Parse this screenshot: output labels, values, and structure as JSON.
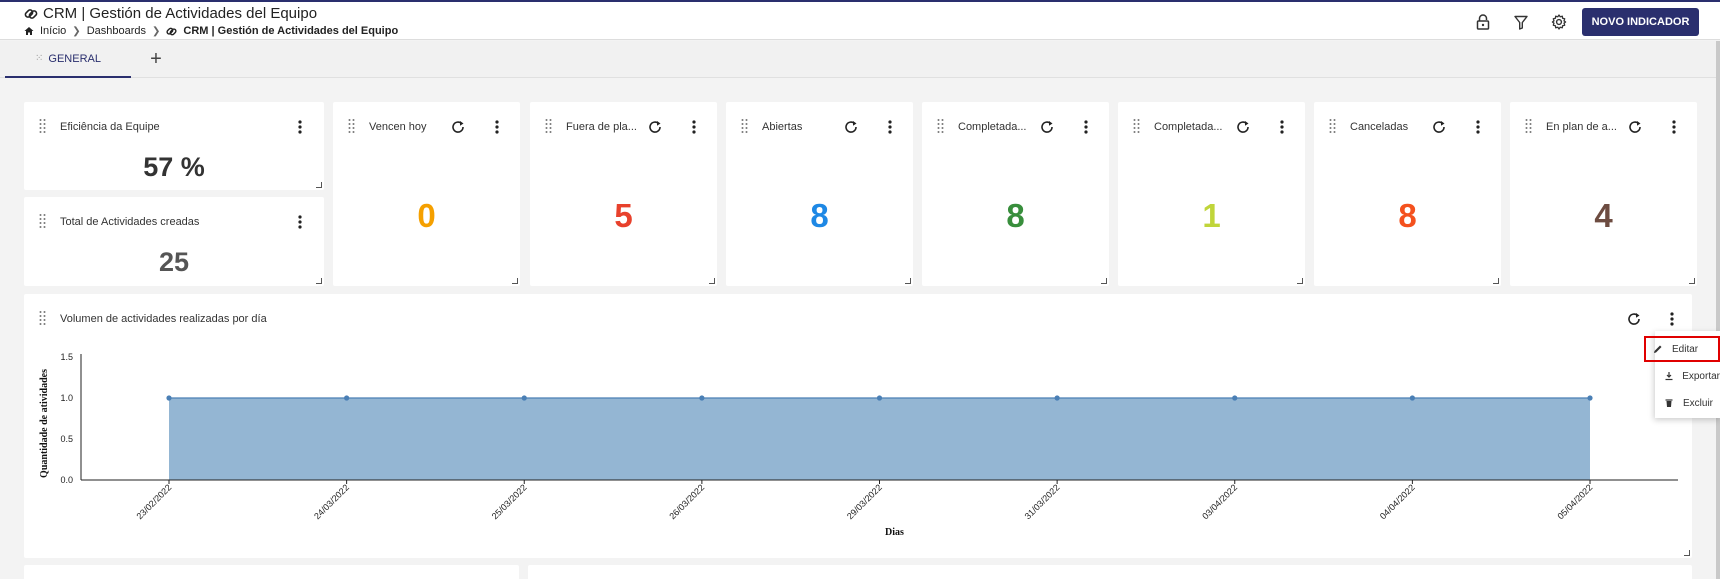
{
  "header": {
    "title": "CRM | Gestión de Actividades del Equipo",
    "breadcrumb": [
      "Início",
      "Dashboards",
      "CRM | Gestión de Actividades del Equipo"
    ],
    "new_button": "NOVO INDICADOR"
  },
  "tabs": [
    {
      "label": "GENERAL"
    }
  ],
  "cards": {
    "eficiencia": {
      "title": "Eficiência da Equipe",
      "value": "57 %"
    },
    "total": {
      "title": "Total de Actividades creadas",
      "value": "25"
    },
    "kpis": [
      {
        "title": "Vencen hoy",
        "value": "0",
        "color": "#f5a000"
      },
      {
        "title": "Fuera de pla...",
        "value": "5",
        "color": "#e8412c"
      },
      {
        "title": "Abiertas",
        "value": "8",
        "color": "#1e88e5"
      },
      {
        "title": "Completada...",
        "value": "8",
        "color": "#388e3c"
      },
      {
        "title": "Completada...",
        "value": "1",
        "color": "#c0d53a"
      },
      {
        "title": "Canceladas",
        "value": "8",
        "color": "#f4511e"
      },
      {
        "title": "En plan de a...",
        "value": "4",
        "color": "#6d4c41"
      }
    ]
  },
  "chart_card": {
    "title": "Volumen de actividades realizadas por día"
  },
  "chart_data": {
    "type": "area",
    "x": [
      "23/02/2022",
      "24/03/2022",
      "25/03/2022",
      "26/03/2022",
      "29/03/2022",
      "31/03/2022",
      "03/04/2022",
      "04/04/2022",
      "05/04/2022"
    ],
    "values": [
      1,
      1,
      1,
      1,
      1,
      1,
      1,
      1,
      1
    ],
    "xlabel": "Dias",
    "ylabel": "Quantidade de atividades",
    "ylim": [
      0,
      1.5
    ],
    "yticks": [
      "0.0",
      "0.5",
      "1.0",
      "1.5"
    ],
    "fill_color": "#94b6d3",
    "line_color": "#4a7fb5"
  },
  "context_menu": {
    "items": [
      {
        "label": "Editar",
        "icon": "pencil-icon"
      },
      {
        "label": "Exportar",
        "icon": "download-icon"
      },
      {
        "label": "Excluir",
        "icon": "trash-icon"
      }
    ]
  },
  "colors": {
    "primary": "#2a2f6e"
  }
}
